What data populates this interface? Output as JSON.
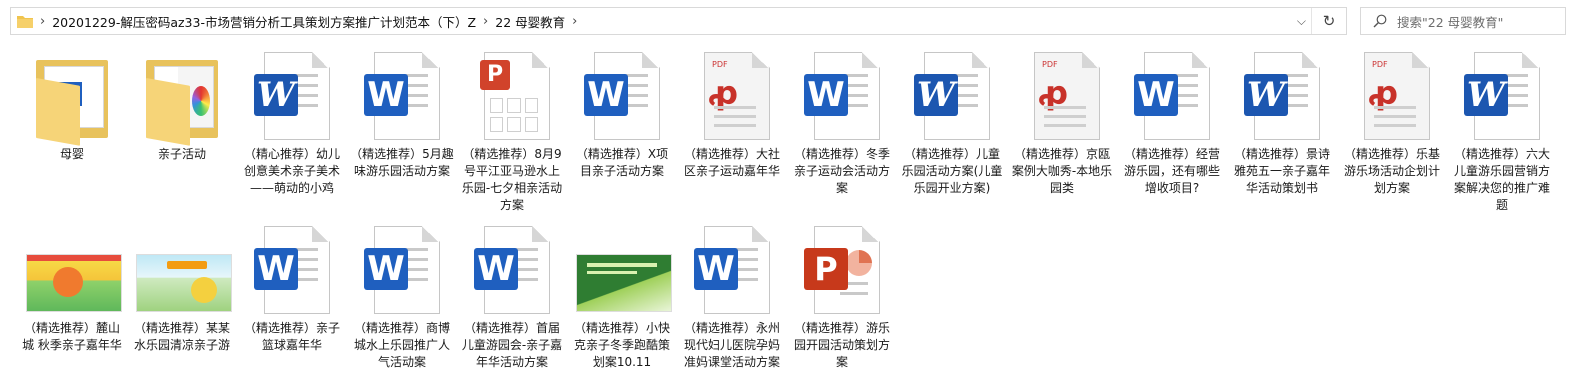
{
  "address_bar": {
    "breadcrumbs": [
      "20201229-解压密码az33-市场营销分析工具策划方案推广计划范本（下）Z",
      "22 母婴教育"
    ],
    "refresh_icon": "refresh-icon",
    "dropdown_icon": "chevron-down-icon"
  },
  "search": {
    "placeholder": "搜索\"22 母婴教育\""
  },
  "items": [
    {
      "label": "母婴",
      "icon": "folder-icon"
    },
    {
      "label": "亲子活动",
      "icon": "folder-icon"
    },
    {
      "label": "（精心推荐）幼儿创意美术亲子美术——萌动的小鸡",
      "icon": "word-doc-icon"
    },
    {
      "label": "（精选推荐）5月趣味游乐园活动方案",
      "icon": "word-doc-icon"
    },
    {
      "label": "（精选推荐）8月9号平江亚马逊水上乐园-七夕相亲活动方案",
      "icon": "ppt-doc-icon"
    },
    {
      "label": "（精选推荐）X项目亲子活动方案",
      "icon": "word-doc-icon"
    },
    {
      "label": "（精选推荐）大社区亲子运动嘉年华",
      "icon": "pdf-doc-icon"
    },
    {
      "label": "（精选推荐）冬季亲子运动会活动方案",
      "icon": "word-doc-icon"
    },
    {
      "label": "（精选推荐）儿童乐园活动方案(儿童乐园开业方案)",
      "icon": "word-doc-icon"
    },
    {
      "label": "（精选推荐）京瓯案例大咖秀-本地乐园类",
      "icon": "pdf-doc-icon"
    },
    {
      "label": "（精选推荐）经营游乐园，还有哪些增收项目?",
      "icon": "word-doc-icon"
    },
    {
      "label": "（精选推荐）景诗雅苑五一亲子嘉年华活动策划书",
      "icon": "word-doc-icon"
    },
    {
      "label": "（精选推荐）乐基游乐场活动企划计划方案",
      "icon": "pdf-doc-icon"
    },
    {
      "label": "（精选推荐）六大儿童游乐园营销方案解决您的推广难题",
      "icon": "word-doc-icon"
    },
    {
      "label": "（精选推荐）麓山城 秋季亲子嘉年华",
      "icon": "image-thumbnail-icon"
    },
    {
      "label": "（精选推荐）某某水乐园清凉亲子游",
      "icon": "image-thumbnail-icon"
    },
    {
      "label": "（精选推荐）亲子篮球嘉年华",
      "icon": "word-doc-icon"
    },
    {
      "label": "（精选推荐）商博城水上乐园推广人气活动案",
      "icon": "word-doc-icon"
    },
    {
      "label": "（精选推荐）首届儿童游园会-亲子嘉年华活动方案",
      "icon": "word-doc-icon"
    },
    {
      "label": "（精选推荐）小快克亲子冬季跑酷策划案10.11",
      "icon": "image-thumbnail-icon"
    },
    {
      "label": "（精选推荐）永州现代妇儿医院孕妈准妈课堂活动方案",
      "icon": "word-doc-icon"
    },
    {
      "label": "（精选推荐）游乐园开园活动策划方案",
      "icon": "ppt-doc-icon"
    }
  ]
}
